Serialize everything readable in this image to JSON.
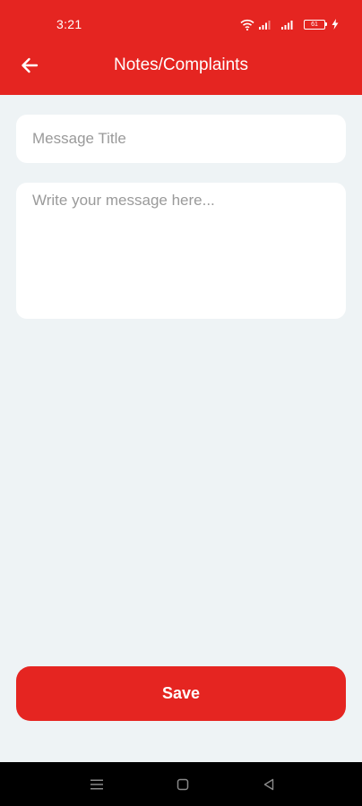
{
  "status_bar": {
    "time": "3:21",
    "battery_level": "61",
    "icons": [
      "wifi-icon",
      "cell-signal-icon",
      "cell-signal-icon",
      "battery-icon",
      "charging-bolt-icon"
    ]
  },
  "header": {
    "title": "Notes/Complaints",
    "back_icon": "arrow-left-icon"
  },
  "form": {
    "title_placeholder": "Message Title",
    "title_value": "",
    "message_placeholder": "Write your message here...",
    "message_value": "",
    "save_label": "Save"
  },
  "nav_bar": {
    "icons": [
      "menu-icon",
      "home-icon",
      "back-triangle-icon"
    ]
  },
  "colors": {
    "primary": "#E52521",
    "background": "#EEF3F5",
    "field_background": "#FFFFFF",
    "placeholder": "#9A9A9A",
    "nav_bar": "#000000"
  }
}
